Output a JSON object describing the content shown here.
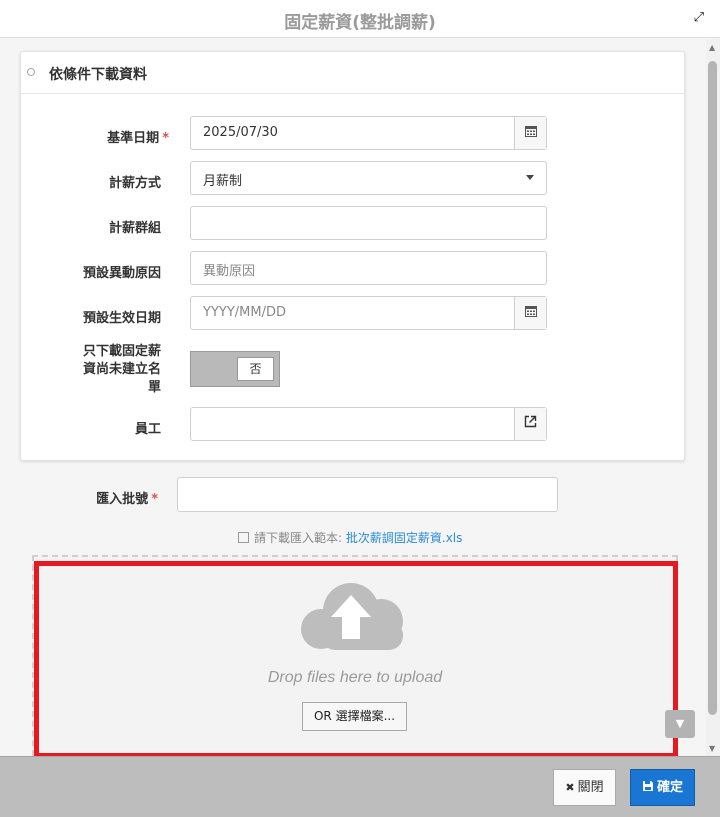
{
  "dialog": {
    "title": "固定薪資(整批調薪)",
    "expand_icon": "⤢"
  },
  "panel": {
    "title": "依條件下載資料",
    "fields": {
      "base_date": {
        "label": "基準日期",
        "required": "*",
        "value": "2025/07/30"
      },
      "pay_method": {
        "label": "計薪方式",
        "value": "月薪制"
      },
      "pay_group": {
        "label": "計薪群組",
        "value": ""
      },
      "change_reason": {
        "label": "預設異動原因",
        "placeholder": "異動原因"
      },
      "effective_date": {
        "label": "預設生效日期",
        "placeholder": "YYYY/MM/DD"
      },
      "only_download": {
        "label": "只下載固定薪資尚未建立名單",
        "toggle_value": "否"
      },
      "employee": {
        "label": "員工",
        "value": ""
      }
    }
  },
  "import_batch": {
    "label": "匯入批號",
    "required": "*",
    "value": ""
  },
  "template": {
    "prefix": "請下載匯入範本:",
    "link": "批次薪調固定薪資.xls"
  },
  "dropzone": {
    "text": "Drop files here to upload",
    "button": "OR 選擇檔案..."
  },
  "footer": {
    "close_label": "關閉",
    "close_icon": "✖",
    "ok_label": "確定"
  },
  "icons": {
    "calendar": "calendar-icon",
    "open_external": "external-link-icon",
    "upload_cloud": "upload-cloud-icon",
    "save": "floppy-icon"
  },
  "colors": {
    "primary": "#1976d2",
    "required": "#d9534f",
    "highlight": "#e5191f",
    "link": "#2a8bd6"
  }
}
